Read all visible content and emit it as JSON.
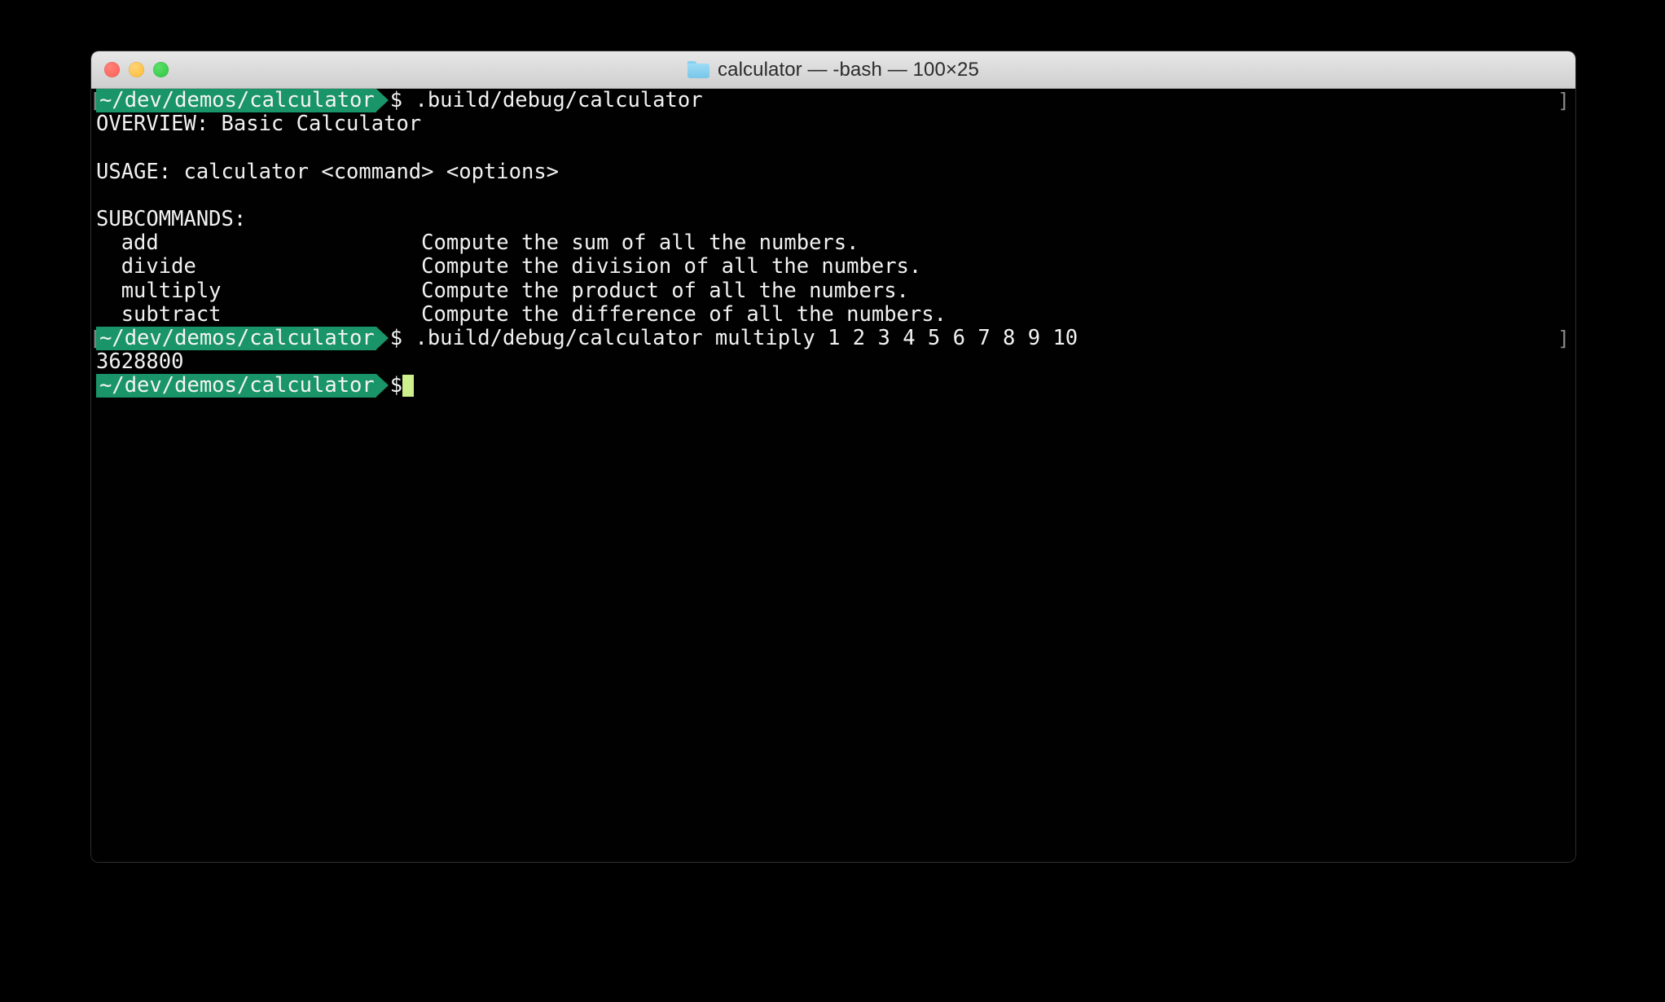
{
  "window": {
    "title": "calculator — -bash — 100×25",
    "folder_icon": "folder-icon",
    "traffic_lights": {
      "close_label": "close",
      "minimize_label": "minimize",
      "maximize_label": "maximize",
      "close_color": "#ff5f57",
      "minimize_color": "#febc2e",
      "maximize_color": "#28c840"
    }
  },
  "theme": {
    "background": "#010101",
    "foreground": "#f2f2f2",
    "prompt_background": "#1a9469",
    "cursor": "#cdf08c",
    "marker": "#8a8a8a"
  },
  "terminal": {
    "prompt": {
      "path": "~/dev/demos/calculator",
      "symbol": "$",
      "bracket_left": "[",
      "bracket_right": "]"
    },
    "lines": [
      {
        "type": "prompt",
        "command": " .build/debug/calculator",
        "mark_left": true,
        "mark_right": true
      },
      {
        "type": "output",
        "text": "OVERVIEW: Basic Calculator"
      },
      {
        "type": "blank",
        "text": ""
      },
      {
        "type": "output",
        "text": "USAGE: calculator <command> <options>"
      },
      {
        "type": "blank",
        "text": ""
      },
      {
        "type": "output",
        "text": "SUBCOMMANDS:"
      },
      {
        "type": "output",
        "text": "  add                     Compute the sum of all the numbers."
      },
      {
        "type": "output",
        "text": "  divide                  Compute the division of all the numbers."
      },
      {
        "type": "output",
        "text": "  multiply                Compute the product of all the numbers."
      },
      {
        "type": "output",
        "text": "  subtract                Compute the difference of all the numbers."
      },
      {
        "type": "prompt",
        "command": " .build/debug/calculator multiply 1 2 3 4 5 6 7 8 9 10",
        "mark_left": true,
        "mark_right": true
      },
      {
        "type": "output",
        "text": "3628800"
      },
      {
        "type": "prompt",
        "command": "",
        "mark_left": false,
        "mark_right": false,
        "cursor": true
      }
    ],
    "subcommands": [
      {
        "name": "add",
        "description": "Compute the sum of all the numbers."
      },
      {
        "name": "divide",
        "description": "Compute the division of all the numbers."
      },
      {
        "name": "multiply",
        "description": "Compute the product of all the numbers."
      },
      {
        "name": "subtract",
        "description": "Compute the difference of all the numbers."
      }
    ],
    "overview": "Basic Calculator",
    "usage": "calculator <command> <options>",
    "result": "3628800"
  }
}
